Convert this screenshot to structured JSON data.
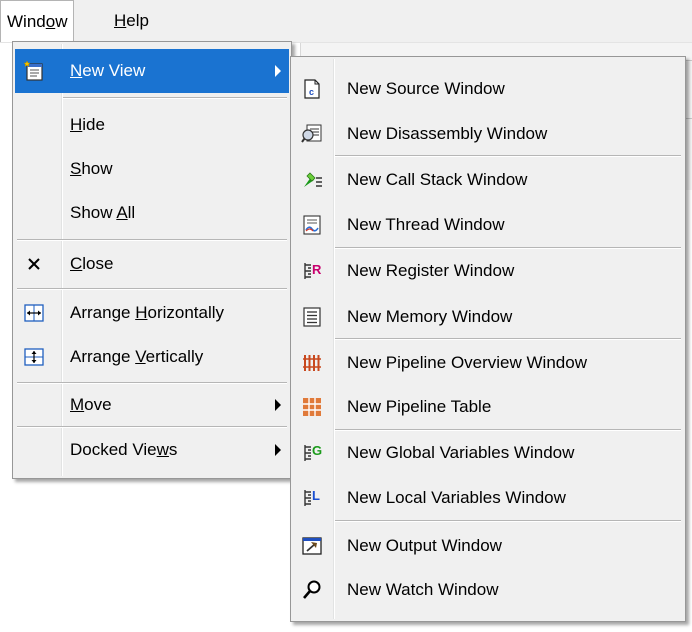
{
  "menubar": {
    "window_label_pre": "Wind",
    "window_label_u": "o",
    "window_label_post": "w",
    "help_label_u": "H",
    "help_label_post": "elp"
  },
  "window_menu": {
    "items": [
      {
        "pre": "",
        "u": "N",
        "post": "ew View",
        "icon": "new-view-icon",
        "submenu": true,
        "highlighted": true
      },
      {
        "pre": "",
        "u": "H",
        "post": "ide"
      },
      {
        "pre": "",
        "u": "S",
        "post": "how"
      },
      {
        "pre": "Show ",
        "u": "A",
        "post": "ll"
      },
      {
        "pre": "",
        "u": "C",
        "post": "lose",
        "icon": "close-icon"
      },
      {
        "pre": "Arrange ",
        "u": "H",
        "post": "orizontally",
        "icon": "arrange-horizontally-icon"
      },
      {
        "pre": "Arrange ",
        "u": "V",
        "post": "ertically",
        "icon": "arrange-vertically-icon"
      },
      {
        "pre": "",
        "u": "M",
        "post": "ove",
        "submenu": true
      },
      {
        "pre": "Docked Vie",
        "u": "w",
        "post": "s",
        "submenu": true
      }
    ]
  },
  "new_view_menu": {
    "items": [
      {
        "label": "New Source Window",
        "icon": "source-file-icon"
      },
      {
        "label": "New Disassembly Window",
        "icon": "disassembly-icon"
      },
      {
        "label": "New Call Stack Window",
        "icon": "call-stack-icon"
      },
      {
        "label": "New Thread Window",
        "icon": "thread-icon"
      },
      {
        "label": "New Register Window",
        "icon": "register-icon"
      },
      {
        "label": "New Memory Window",
        "icon": "memory-icon"
      },
      {
        "label": "New Pipeline Overview Window",
        "icon": "pipeline-overview-icon"
      },
      {
        "label": "New Pipeline Table",
        "icon": "pipeline-table-icon"
      },
      {
        "label": "New Global Variables Window",
        "icon": "global-variables-icon"
      },
      {
        "label": "New Local Variables Window",
        "icon": "local-variables-icon"
      },
      {
        "label": "New Output  Window",
        "icon": "output-icon"
      },
      {
        "label": "New Watch Window",
        "icon": "watch-icon"
      }
    ]
  },
  "colors": {
    "highlight": "#1a73d1",
    "menu_bg": "#f0f0f0",
    "register_letter": "#c8006e",
    "global_letter": "#1a9a1a",
    "local_letter": "#1a4fd1",
    "pipeline": "#c8481e"
  }
}
